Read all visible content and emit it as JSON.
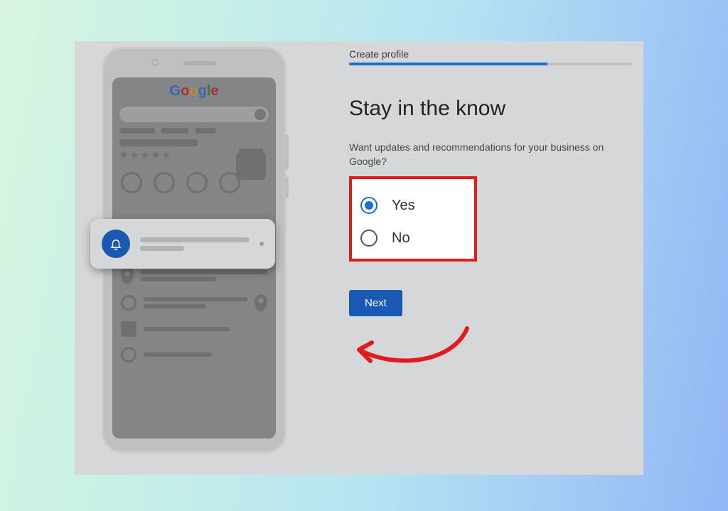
{
  "phone": {
    "logo_letters": [
      "G",
      "o",
      "o",
      "g",
      "l",
      "e"
    ]
  },
  "form": {
    "step_label": "Create profile",
    "progress_percent": 70,
    "heading": "Stay in the know",
    "subtext": "Want updates and recommendations for your business on Google?",
    "options": {
      "yes": "Yes",
      "no": "No"
    },
    "selected": "yes",
    "next_label": "Next"
  },
  "annotation": {
    "highlight_color": "#e11b1b",
    "arrow_color": "#e11b1b"
  }
}
